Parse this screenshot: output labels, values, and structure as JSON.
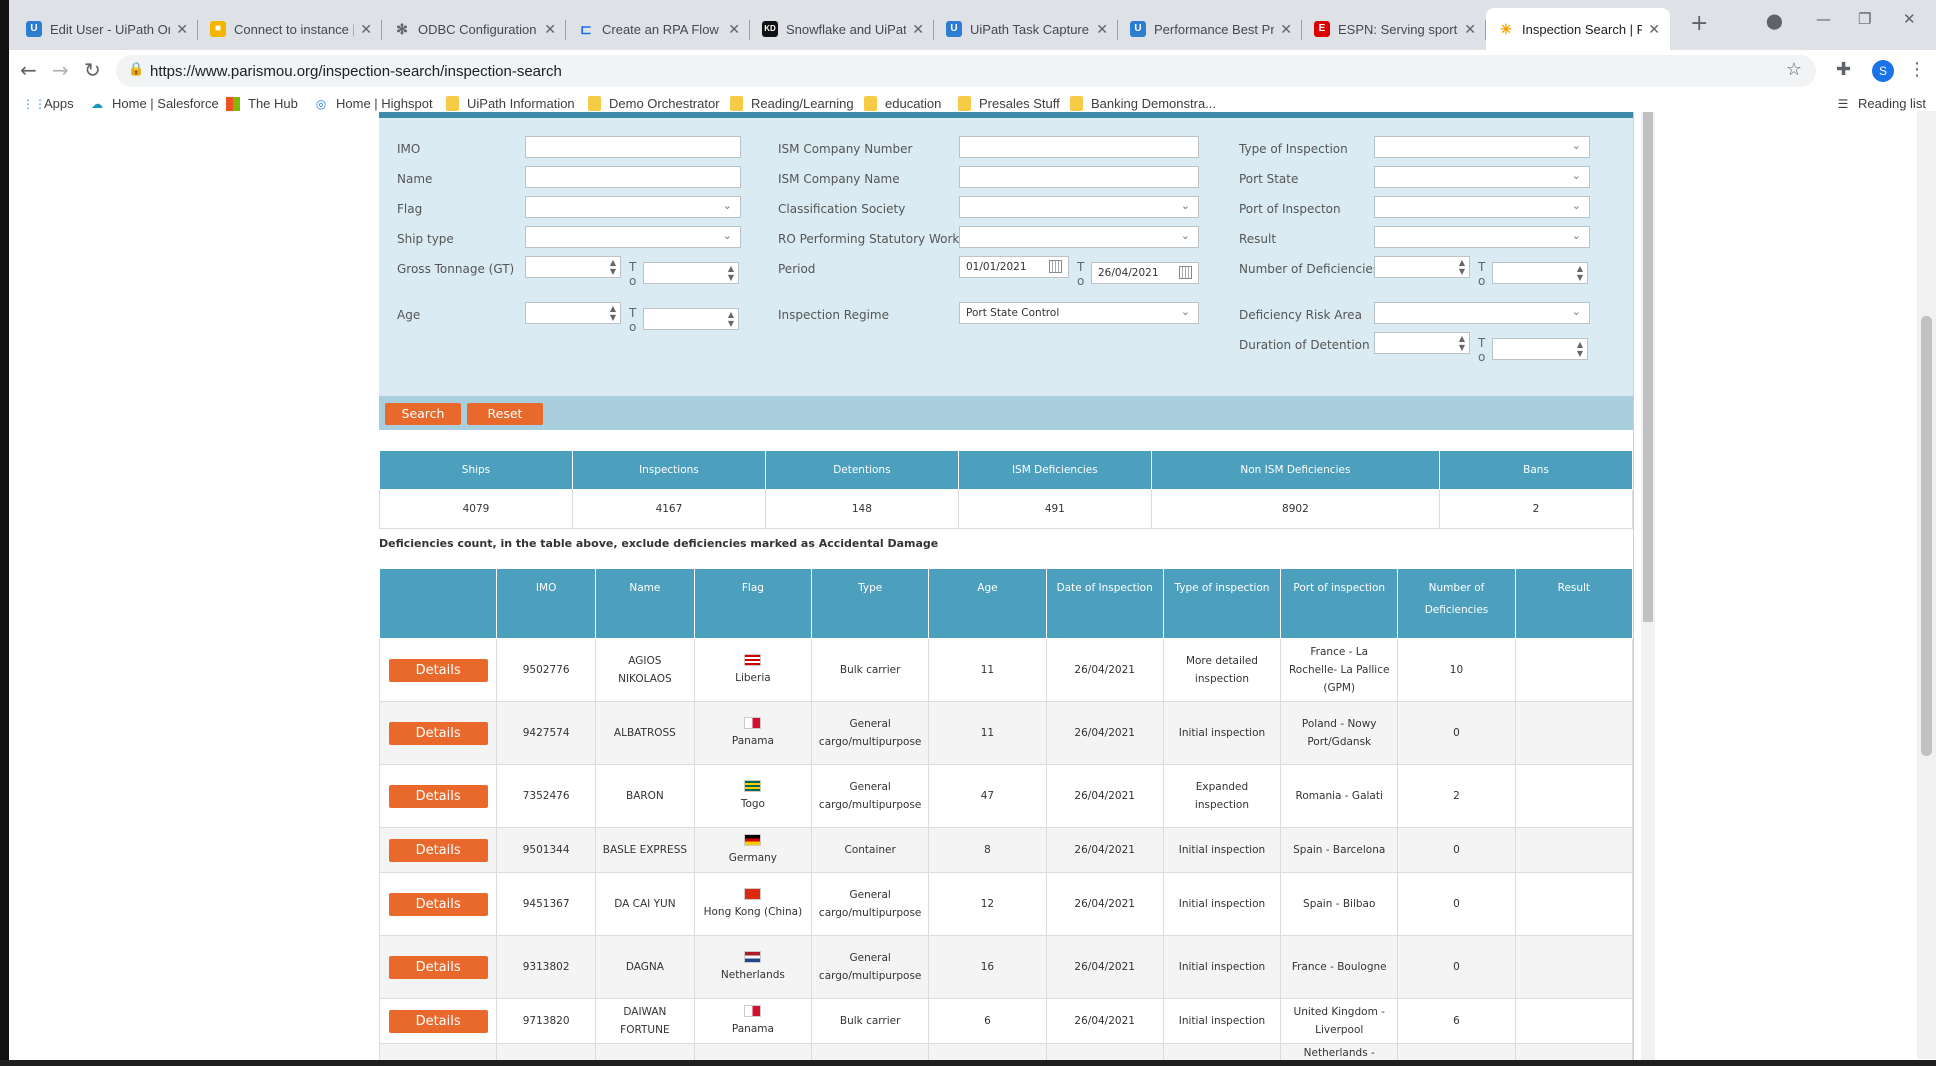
{
  "browser": {
    "tabs": [
      {
        "title": "Edit User - UiPath Orchestrator",
        "favicon": "uipath-icon",
        "color": "#2d7dd2"
      },
      {
        "title": "Connect to instance | Box",
        "favicon": "box-icon",
        "color": "#f5b400"
      },
      {
        "title": "ODBC Configuration and Connection",
        "favicon": "snowflake-icon",
        "color": "#5f6368"
      },
      {
        "title": "Create an RPA Flow that",
        "favicon": "rpa-icon",
        "color": "#1a73e8"
      },
      {
        "title": "Snowflake and UiPath",
        "favicon": "kd-icon",
        "color": "#111111"
      },
      {
        "title": "UiPath Task Capture",
        "favicon": "uipath-icon",
        "color": "#2d7dd2"
      },
      {
        "title": "Performance Best Practices",
        "favicon": "uipath-icon",
        "color": "#2d7dd2"
      },
      {
        "title": "ESPN: Serving sports fans",
        "favicon": "espn-icon",
        "color": "#d00"
      },
      {
        "title": "Inspection Search | Paris MoU",
        "favicon": "star-icon",
        "color": "#f0a500",
        "active": true
      }
    ],
    "url": "https://www.parismou.org/inspection-search/inspection-search",
    "profile_initial": "S",
    "bookmarks": [
      {
        "label": "Apps",
        "icon": "apps-grid-icon"
      },
      {
        "label": "Home | Salesforce",
        "icon": "salesforce-cloud-icon"
      },
      {
        "label": "The Hub",
        "icon": "microsoft-icon"
      },
      {
        "label": "Home | Highspot",
        "icon": "highspot-icon"
      },
      {
        "label": "UiPath Information",
        "icon": "folder-icon"
      },
      {
        "label": "Demo Orchestrator",
        "icon": "folder-icon"
      },
      {
        "label": "Reading/Learning",
        "icon": "folder-icon"
      },
      {
        "label": "education",
        "icon": "folder-icon"
      },
      {
        "label": "Presales Stuff",
        "icon": "folder-icon"
      },
      {
        "label": "Banking Demonstra...",
        "icon": "folder-icon"
      }
    ],
    "reading_list": "Reading list"
  },
  "search": {
    "col1": {
      "imo": "IMO",
      "name": "Name",
      "flag": "Flag",
      "ship_type": "Ship type",
      "gross_tonnage": "Gross Tonnage (GT)",
      "age": "Age"
    },
    "col2": {
      "ism_company_number": "ISM Company Number",
      "ism_company_name": "ISM Company Name",
      "classification_society": "Classification Society",
      "ro_performing": "RO Performing Statutory Work",
      "period": "Period",
      "period_from": "01/01/2021",
      "period_to": "26/04/2021",
      "inspection_regime": "Inspection Regime",
      "inspection_regime_value": "Port State Control"
    },
    "col3": {
      "type_of_inspection": "Type of Inspection",
      "port_state": "Port State",
      "port_of_inspection": "Port of Inspecton",
      "result": "Result",
      "number_of_deficiencies": "Number of Deficiencies",
      "deficiency_risk_area": "Deficiency Risk Area",
      "duration_of_detention": "Duration of Detention"
    },
    "to_label_t": "T",
    "to_label_o": "o",
    "search_button": "Search",
    "reset_button": "Reset"
  },
  "stats": {
    "headers": [
      "Ships",
      "Inspections",
      "Detentions",
      "ISM Deficiencies",
      "Non ISM Deficiencies",
      "Bans"
    ],
    "values": [
      "4079",
      "4167",
      "148",
      "491",
      "8902",
      "2"
    ]
  },
  "note": "Deficiencies count, in the table above, exclude deficiencies marked as Accidental Damage",
  "results": {
    "headers": [
      "",
      "IMO",
      "Name",
      "Flag",
      "Type",
      "Age",
      "Date of Inspection",
      "Type of inspection",
      "Port of inspection",
      "Number of Deficiencies",
      "Result"
    ],
    "details_label": "Details",
    "rows": [
      {
        "imo": "9502776",
        "name": "AGIOS NIKOLAOS",
        "flag": "Liberia",
        "type": "Bulk carrier",
        "age": "11",
        "date": "26/04/2021",
        "inspection_type": "More detailed inspection",
        "port": "France - La Rochelle- La Pallice (GPM)",
        "deficiencies": "10",
        "result": ""
      },
      {
        "imo": "9427574",
        "name": "ALBATROSS",
        "flag": "Panama",
        "type": "General cargo/multipurpose",
        "age": "11",
        "date": "26/04/2021",
        "inspection_type": "Initial inspection",
        "port": "Poland - Nowy Port/Gdansk",
        "deficiencies": "0",
        "result": ""
      },
      {
        "imo": "7352476",
        "name": "BARON",
        "flag": "Togo",
        "type": "General cargo/multipurpose",
        "age": "47",
        "date": "26/04/2021",
        "inspection_type": "Expanded inspection",
        "port": "Romania - Galati",
        "deficiencies": "2",
        "result": ""
      },
      {
        "imo": "9501344",
        "name": "BASLE EXPRESS",
        "flag": "Germany",
        "type": "Container",
        "age": "8",
        "date": "26/04/2021",
        "inspection_type": "Initial inspection",
        "port": "Spain - Barcelona",
        "deficiencies": "0",
        "result": ""
      },
      {
        "imo": "9451367",
        "name": "DA CAI YUN",
        "flag": "Hong Kong (China)",
        "type": "General cargo/multipurpose",
        "age": "12",
        "date": "26/04/2021",
        "inspection_type": "Initial inspection",
        "port": "Spain - Bilbao",
        "deficiencies": "0",
        "result": ""
      },
      {
        "imo": "9313802",
        "name": "DAGNA",
        "flag": "Netherlands",
        "type": "General cargo/multipurpose",
        "age": "16",
        "date": "26/04/2021",
        "inspection_type": "Initial inspection",
        "port": "France - Boulogne",
        "deficiencies": "0",
        "result": ""
      },
      {
        "imo": "9713820",
        "name": "DAIWAN FORTUNE",
        "flag": "Panama",
        "type": "Bulk carrier",
        "age": "6",
        "date": "26/04/2021",
        "inspection_type": "Initial inspection",
        "port": "United Kingdom - Liverpool",
        "deficiencies": "6",
        "result": ""
      }
    ],
    "partial_row_port": "Netherlands -"
  },
  "colors": {
    "accent_orange": "#e9692c",
    "header_blue": "#4da0bd",
    "panel_blue": "#daebf3"
  }
}
